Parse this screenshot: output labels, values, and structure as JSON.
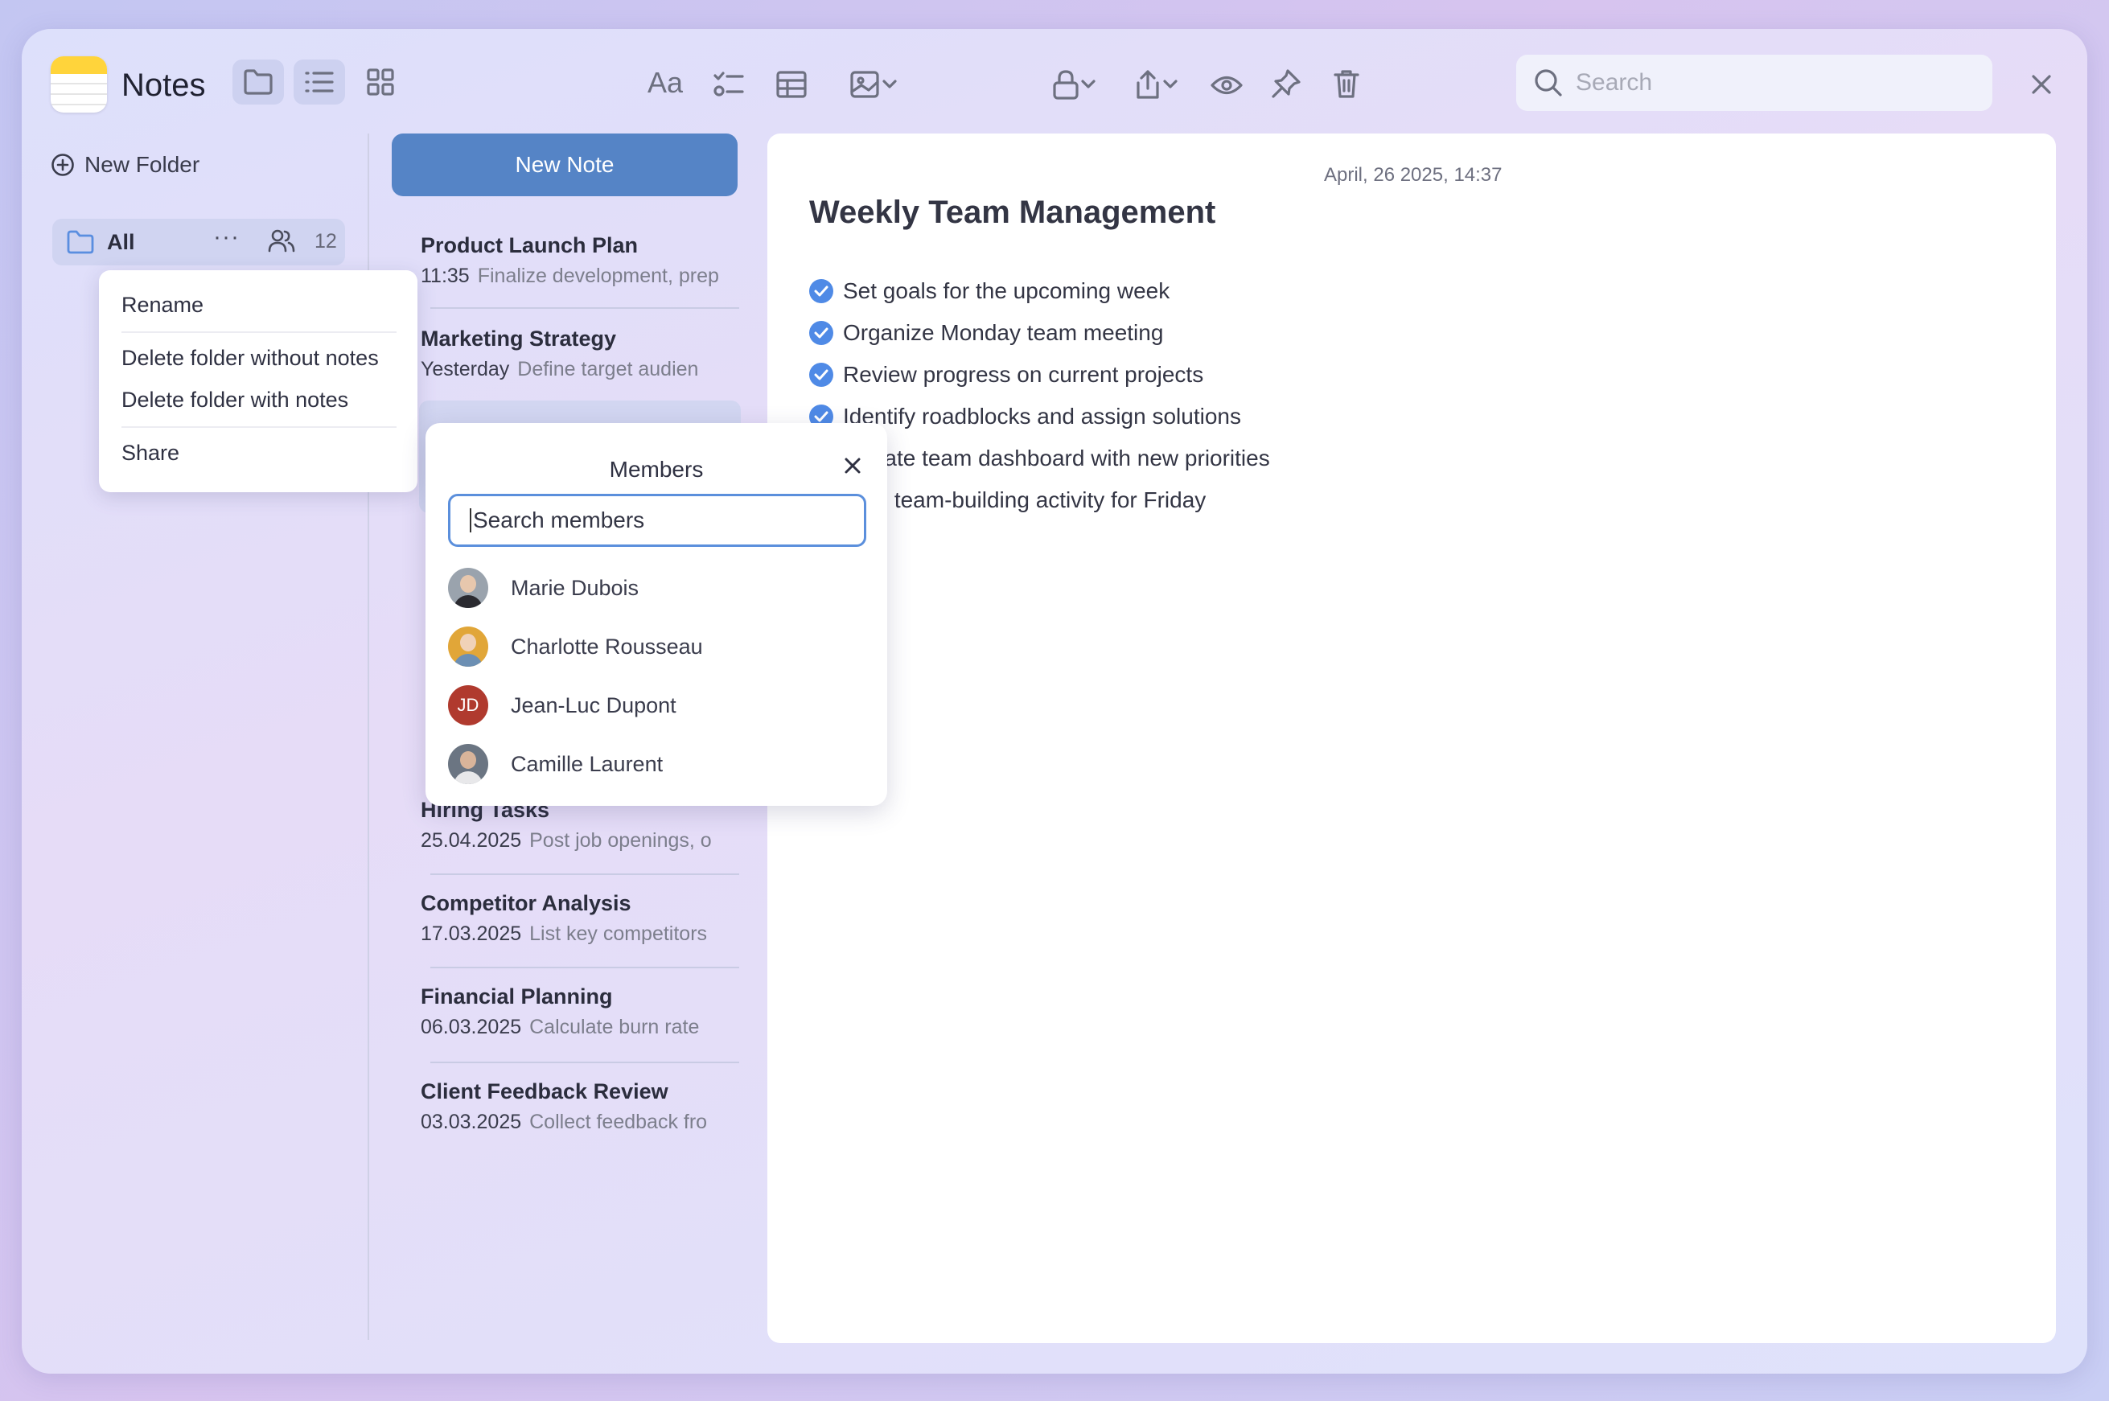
{
  "app": {
    "title": "Notes"
  },
  "search": {
    "placeholder": "Search"
  },
  "sidebar": {
    "new_folder": "New Folder",
    "folder": {
      "name": "All",
      "more": "···",
      "count": "12"
    }
  },
  "context_menu": {
    "items": [
      "Rename",
      "Delete folder without notes",
      "Delete folder with notes",
      "Share"
    ]
  },
  "notes": {
    "new_note": "New Note",
    "items": [
      {
        "title": "Product Launch Plan",
        "date": "11:35",
        "preview": "Finalize development, prep"
      },
      {
        "title": "Marketing Strategy",
        "date": "Yesterday",
        "preview": "Define target audien"
      },
      {
        "title": "Hiring Tasks",
        "date": "25.04.2025",
        "preview": "Post job openings, o"
      },
      {
        "title": "Competitor Analysis",
        "date": "17.03.2025",
        "preview": "List key competitors"
      },
      {
        "title": "Financial Planning",
        "date": "06.03.2025",
        "preview": "Calculate burn rate"
      },
      {
        "title": "Client Feedback Review",
        "date": "03.03.2025",
        "preview": "Collect feedback fro"
      }
    ]
  },
  "editor": {
    "date": "April, 26 2025, 14:37",
    "title": "Weekly Team Management",
    "tasks": [
      {
        "text": "Set goals for the upcoming week",
        "done": true
      },
      {
        "text": "Organize Monday team meeting",
        "done": true
      },
      {
        "text": "Review progress on current projects",
        "done": true
      },
      {
        "text": "Identify roadblocks and assign solutions",
        "done": true
      },
      {
        "text": "Update team dashboard with new priorities",
        "done": false
      },
      {
        "text": "Plan team-building activity for Friday",
        "done": false
      }
    ]
  },
  "members": {
    "title": "Members",
    "search_placeholder": "Search members",
    "list": [
      {
        "name": "Marie Dubois",
        "initials": ""
      },
      {
        "name": "Charlotte Rousseau",
        "initials": ""
      },
      {
        "name": "Jean-Luc Dupont",
        "initials": "JD"
      },
      {
        "name": "Camille Laurent",
        "initials": ""
      }
    ]
  },
  "colors": {
    "accent": "#5584c6",
    "check": "#4f8ae6",
    "avatar_jd": "#b03a2e"
  }
}
